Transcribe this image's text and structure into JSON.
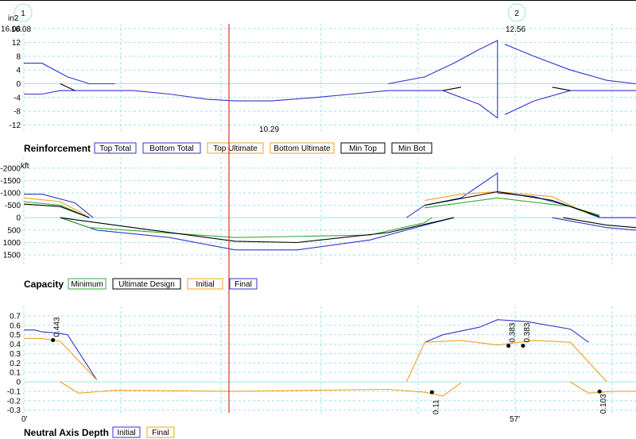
{
  "support_markers": [
    "1",
    "2"
  ],
  "x_axis": {
    "start_label": "0'",
    "mid_label": "57'"
  },
  "chart_data": [
    {
      "type": "line",
      "title": "Reinforcement",
      "ylabel": "in2",
      "ylim": [
        -14,
        16.08
      ],
      "y_ticks": [
        "16.08",
        "12",
        "8",
        "4",
        "0",
        "-4",
        "-8",
        "-12"
      ],
      "grid": true,
      "annotations": [
        "12.56",
        "10.29"
      ],
      "legend": [
        {
          "label": "Top Total",
          "color": "#3333cc"
        },
        {
          "label": "Bottom Total",
          "color": "#3333cc"
        },
        {
          "label": "Top Ultimate",
          "color": "#f0a020"
        },
        {
          "label": "Bottom Ultimate",
          "color": "#f0a020"
        },
        {
          "label": "Min Top",
          "color": "#000000"
        },
        {
          "label": "Min Bot",
          "color": "#000000"
        }
      ],
      "series": [
        {
          "color": "#3333cc",
          "segments": [
            [
              [
                0,
                6
              ],
              [
                5,
                6
              ],
              [
                12,
                2
              ],
              [
                18,
                0
              ],
              [
                25,
                0
              ]
            ],
            [
              [
                100,
                0
              ],
              [
                110,
                2
              ],
              [
                118,
                6
              ],
              [
                125,
                10
              ],
              [
                130,
                12.6
              ],
              [
                130,
                0
              ]
            ],
            [
              [
                132,
                11.5
              ],
              [
                140,
                8
              ],
              [
                150,
                4
              ],
              [
                160,
                1
              ],
              [
                168,
                0
              ]
            ]
          ]
        },
        {
          "color": "#3333cc",
          "segments": [
            [
              [
                0,
                -3
              ],
              [
                5,
                -3
              ],
              [
                10,
                -2
              ],
              [
                20,
                -2
              ],
              [
                30,
                -2
              ],
              [
                40,
                -3
              ],
              [
                50,
                -4.5
              ],
              [
                58,
                -5
              ],
              [
                68,
                -5
              ],
              [
                80,
                -4
              ],
              [
                90,
                -3
              ],
              [
                100,
                -2
              ],
              [
                115,
                -2
              ],
              [
                125,
                -6
              ],
              [
                130,
                -10
              ],
              [
                130,
                0
              ]
            ],
            [
              [
                132,
                -9
              ],
              [
                140,
                -5
              ],
              [
                150,
                -2
              ],
              [
                160,
                -2
              ],
              [
                168,
                -2
              ]
            ]
          ]
        },
        {
          "color": "#000000",
          "segments": [
            [
              [
                10,
                0
              ],
              [
                14,
                -2
              ]
            ],
            [
              [
                115,
                -2
              ],
              [
                120,
                -1
              ]
            ],
            [
              [
                145,
                -1
              ],
              [
                150,
                -2
              ]
            ]
          ]
        }
      ]
    },
    {
      "type": "line",
      "title": "Capacity",
      "ylabel": "kft",
      "ylim": [
        -2250,
        1850
      ],
      "y_ticks": [
        "-2000",
        "-1500",
        "-1000",
        "-500",
        "0",
        "500",
        "1000",
        "1500"
      ],
      "grid": true,
      "legend": [
        {
          "label": "Minimum",
          "color": "#33aa33"
        },
        {
          "label": "Ultimate Design",
          "color": "#000000"
        },
        {
          "label": "Initial",
          "color": "#f0a020"
        },
        {
          "label": "Final",
          "color": "#3333cc"
        }
      ],
      "series": [
        {
          "color": "#3333cc",
          "segments": [
            [
              [
                0,
                -950
              ],
              [
                5,
                -950
              ],
              [
                14,
                -600
              ],
              [
                19,
                0
              ]
            ],
            [
              [
                10,
                0
              ],
              [
                20,
                500
              ],
              [
                40,
                800
              ],
              [
                58,
                1300
              ],
              [
                75,
                1300
              ],
              [
                95,
                900
              ],
              [
                110,
                300
              ],
              [
                118,
                0
              ]
            ],
            [
              [
                105,
                0
              ],
              [
                110,
                -500
              ],
              [
                120,
                -800
              ],
              [
                130,
                -1800
              ],
              [
                130,
                -1000
              ],
              [
                140,
                -850
              ],
              [
                150,
                -450
              ],
              [
                158,
                0
              ],
              [
                168,
                0
              ]
            ],
            [
              [
                145,
                0
              ],
              [
                160,
                400
              ],
              [
                168,
                500
              ]
            ]
          ]
        },
        {
          "color": "#f0a020",
          "segments": [
            [
              [
                0,
                -800
              ],
              [
                10,
                -650
              ],
              [
                17,
                -100
              ]
            ],
            [
              [
                110,
                -700
              ],
              [
                120,
                -950
              ],
              [
                130,
                -1050
              ],
              [
                145,
                -850
              ],
              [
                155,
                -150
              ]
            ]
          ]
        },
        {
          "color": "#33aa33",
          "segments": [
            [
              [
                0,
                -650
              ],
              [
                10,
                -500
              ],
              [
                18,
                0
              ]
            ],
            [
              [
                10,
                0
              ],
              [
                18,
                400
              ],
              [
                58,
                800
              ],
              [
                95,
                700
              ],
              [
                110,
                200
              ],
              [
                112,
                0
              ]
            ],
            [
              [
                110,
                -400
              ],
              [
                130,
                -800
              ],
              [
                150,
                -450
              ],
              [
                158,
                -100
              ]
            ]
          ]
        },
        {
          "color": "#000000",
          "segments": [
            [
              [
                0,
                -550
              ],
              [
                10,
                -450
              ],
              [
                18,
                0
              ]
            ],
            [
              [
                10,
                0
              ],
              [
                30,
                400
              ],
              [
                58,
                950
              ],
              [
                75,
                1000
              ],
              [
                100,
                600
              ],
              [
                118,
                0
              ]
            ],
            [
              [
                110,
                -500
              ],
              [
                130,
                -1050
              ],
              [
                145,
                -700
              ],
              [
                158,
                -50
              ]
            ],
            [
              [
                148,
                0
              ],
              [
                160,
                300
              ],
              [
                168,
                400
              ]
            ]
          ]
        }
      ]
    },
    {
      "type": "line",
      "title": "Neutral Axis Depth",
      "ylim": [
        -0.32,
        0.75
      ],
      "y_ticks": [
        "0.7",
        "0.6",
        "0.5",
        "0.4",
        "0.3",
        "0.2",
        "0.1",
        "0",
        "-0.1",
        "-0.2",
        "-0.3"
      ],
      "grid": true,
      "annotations": [
        "0.443",
        "0.383",
        "0.383",
        "0.11",
        "0.103"
      ],
      "legend": [
        {
          "label": "Initial",
          "color": "#3333cc"
        },
        {
          "label": "Final",
          "color": "#f0a020"
        }
      ],
      "series": [
        {
          "color": "#3333cc",
          "segments": [
            [
              [
                0,
                0.55
              ],
              [
                3,
                0.55
              ],
              [
                5,
                0.53
              ],
              [
                9,
                0.52
              ],
              [
                12,
                0.5
              ],
              [
                20,
                0.02
              ]
            ],
            [
              [
                110,
                0.42
              ],
              [
                115,
                0.5
              ],
              [
                125,
                0.58
              ],
              [
                130,
                0.66
              ],
              [
                138,
                0.64
              ],
              [
                150,
                0.56
              ],
              [
                155,
                0.42
              ]
            ]
          ]
        },
        {
          "color": "#f0a020",
          "segments": [
            [
              [
                0,
                0.46
              ],
              [
                5,
                0.46
              ],
              [
                10,
                0.43
              ],
              [
                20,
                0.02
              ]
            ],
            [
              [
                10,
                0
              ],
              [
                15,
                -0.12
              ],
              [
                25,
                -0.09
              ],
              [
                58,
                -0.1
              ],
              [
                100,
                -0.08
              ],
              [
                110,
                -0.11
              ],
              [
                115,
                -0.15
              ],
              [
                120,
                -0.01
              ]
            ],
            [
              [
                105,
                0
              ],
              [
                110,
                0.42
              ],
              [
                120,
                0.44
              ],
              [
                130,
                0.39
              ],
              [
                140,
                0.44
              ],
              [
                150,
                0.42
              ],
              [
                160,
                0
              ]
            ],
            [
              [
                150,
                0
              ],
              [
                155,
                -0.12
              ],
              [
                162,
                -0.1
              ],
              [
                168,
                -0.1
              ]
            ]
          ]
        }
      ],
      "points": [
        {
          "x": 8,
          "y": 0.443,
          "label": "0.443"
        },
        {
          "x": 133,
          "y": 0.383,
          "label": "0.383"
        },
        {
          "x": 137,
          "y": 0.383,
          "label": "0.383"
        },
        {
          "x": 112,
          "y": -0.11,
          "label": "0.11"
        },
        {
          "x": 158,
          "y": -0.103,
          "label": "0.103"
        }
      ]
    }
  ],
  "colors": {
    "grid": "#9fe3e3",
    "cursor": "#e03030"
  }
}
